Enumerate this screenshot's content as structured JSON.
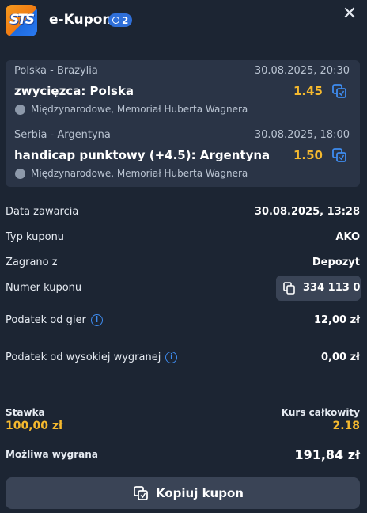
{
  "header": {
    "logo_text": "STS",
    "title": "e-Kupon",
    "count": "2",
    "close_icon": "close-icon"
  },
  "bets": [
    {
      "match": "Polska - Brazylia",
      "date": "30.08.2025, 20:30",
      "pick": "zwycięzca: Polska",
      "odds": "1.45",
      "league": "Międzynarodowe, Memoriał Huberta Wagnera",
      "sport_icon": "volleyball-icon"
    },
    {
      "match": "Serbia - Argentyna",
      "date": "30.08.2025, 18:00",
      "pick": "handicap punktowy (+4.5): Argentyna",
      "odds": "1.50",
      "league": "Międzynarodowe, Memoriał Huberta Wagnera",
      "sport_icon": "volleyball-icon"
    }
  ],
  "details": {
    "date": {
      "label": "Data zawarcia",
      "value": "30.08.2025, 13:28"
    },
    "type": {
      "label": "Typ kuponu",
      "value": "AKO"
    },
    "played_from": {
      "label": "Zagrano z",
      "value": "Depozyt"
    },
    "number": {
      "label": "Numer kuponu",
      "value": "334 113 0"
    },
    "tax": {
      "label": "Podatek od gier",
      "value": "12,00 zł"
    },
    "high_win_tax": {
      "label": "Podatek od wysokiej wygranej",
      "value": "0,00 zł"
    }
  },
  "summary": {
    "stake_label": "Stawka",
    "stake_value": "100,00 zł",
    "total_odds_label": "Kurs całkowity",
    "total_odds_value": "2.18",
    "possible_win_label": "Możliwa wygrana",
    "possible_win_value": "191,84 zł"
  },
  "copy_button": {
    "label": "Kopiuj kupon"
  },
  "colors": {
    "background": "#1c2533",
    "card": "#2a3446",
    "accent_odds": "#f5b92e",
    "link_blue": "#3e8cf0",
    "button": "#3a4456"
  }
}
